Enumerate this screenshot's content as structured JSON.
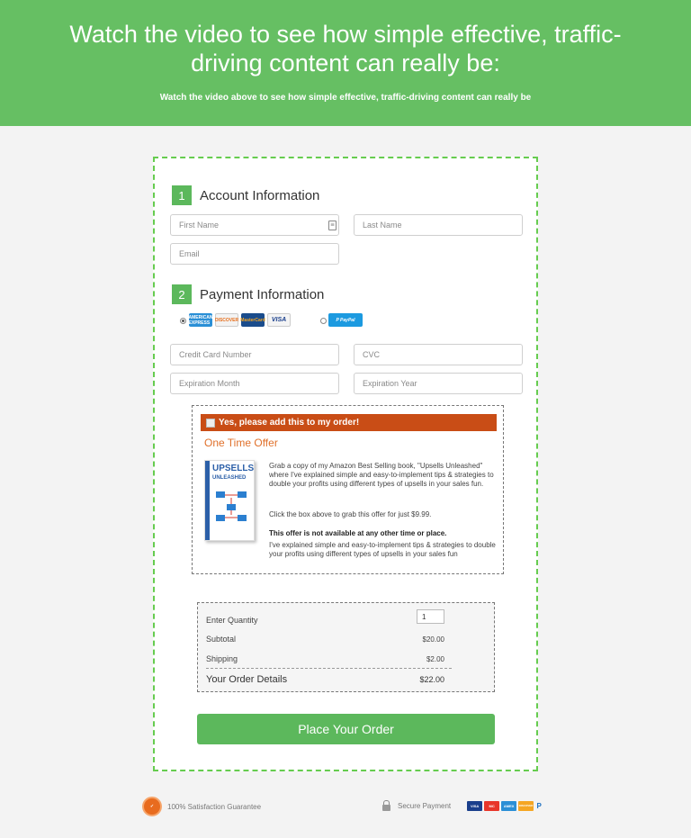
{
  "hero": {
    "title": "Watch the video to see how simple effective, traffic-driving content can really be:",
    "subtitle": "Watch the video above to see how simple effective, traffic-driving content can really be"
  },
  "account": {
    "step_number": "1",
    "title": "Account Information",
    "first_name_placeholder": "First Name",
    "last_name_placeholder": "Last Name",
    "email_placeholder": "Email"
  },
  "payment": {
    "step_number": "2",
    "title": "Payment Information",
    "cards": [
      "AMERICAN EXPRESS",
      "DISCOVER",
      "MasterCard",
      "VISA"
    ],
    "paypal_label": "P PayPal",
    "card_number_placeholder": "Credit Card Number",
    "cvc_placeholder": "CVC",
    "exp_month_placeholder": "Expiration Month",
    "exp_year_placeholder": "Expiration Year"
  },
  "upsell": {
    "checkbox_label": "Yes, please add this to my order!",
    "title": "One Time Offer",
    "book_title_1": "UPSELLS",
    "book_title_2": "UNLEASHED",
    "paragraph_1": "Grab a copy of my Amazon Best Selling book, \"Upsells Unleashed\" where I've explained simple and easy-to-implement tips & strategies to double your profits using different types of upsells in your sales fun.",
    "paragraph_2": "Click the box above to grab this offer for just $9.99.",
    "paragraph_3": "This offer is not available at any other time or place.",
    "paragraph_4": "I've explained simple and easy-to-implement tips & strategies to double your profits using different types of upsells in your sales fun"
  },
  "summary": {
    "quantity_label": "Enter Quantity",
    "quantity_value": "1",
    "subtotal_label": "Subtotal",
    "subtotal_value": "$20.00",
    "shipping_label": "Shipping",
    "shipping_value": "$2.00",
    "total_label": "Your Order Details",
    "total_value": "$22.00"
  },
  "order_button": "Place Your Order",
  "footer": {
    "guarantee": "100% Satisfaction Guarantee",
    "secure": "Secure Payment",
    "cards": [
      "VISA",
      "MC",
      "AMEX",
      "DISCOVER",
      "P"
    ]
  },
  "colors": {
    "brand_green": "#66bf63",
    "button_green": "#5cb85c",
    "upsell_orange": "#c94d16",
    "offer_orange": "#e0702a"
  }
}
